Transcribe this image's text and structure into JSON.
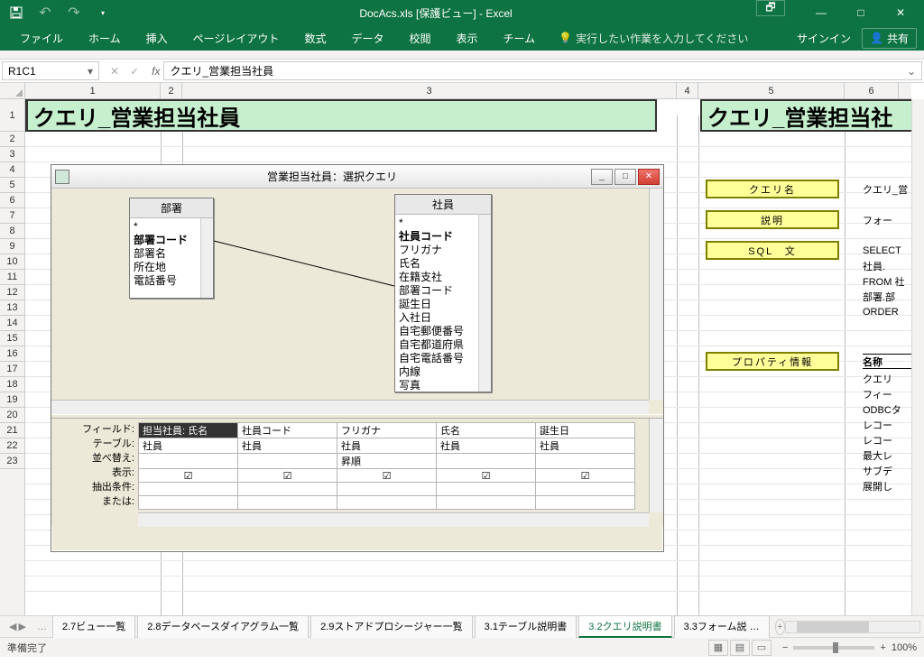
{
  "titlebar": {
    "title": "DocAcs.xls [保護ビュー] - Excel"
  },
  "win": {
    "restore": "🗗",
    "min": "—",
    "max": "□",
    "close": "✕"
  },
  "ribbon": {
    "tabs": [
      "ファイル",
      "ホーム",
      "挿入",
      "ページレイアウト",
      "数式",
      "データ",
      "校閲",
      "表示",
      "チーム"
    ],
    "tell_me": "実行したい作業を入力してください",
    "signin": "サインイン",
    "share": "共有"
  },
  "fbar": {
    "name": "R1C1",
    "value": "クエリ_営業担当社員",
    "fx": "fx"
  },
  "colhead": {
    "c1": "1",
    "c2": "2",
    "c3": "3",
    "c4": "4",
    "c5": "5",
    "c6": "6"
  },
  "rowhead": [
    "1",
    "2",
    "3",
    "4",
    "5",
    "6",
    "7",
    "8",
    "9",
    "10",
    "11",
    "12",
    "13",
    "14",
    "15",
    "16",
    "17",
    "18",
    "19",
    "20",
    "21",
    "22",
    "23"
  ],
  "banner": {
    "text": "クエリ_営業担当社員",
    "text2": "クエリ_営業担当社"
  },
  "right_labels": {
    "query_name": "クエリ名",
    "description": "説明",
    "sql": "SQL　文",
    "props": "プロパティ情報"
  },
  "right_cells": {
    "r3": "クエリ_営",
    "r5": "フォー",
    "r7": "SELECT",
    "r8": "社員.",
    "r9": "FROM 社",
    "r10": "部署.部",
    "r11": "ORDER",
    "r13": "名称",
    "r14": "クエリ",
    "r15": "フィー",
    "r16": "ODBCタ",
    "r17": "レコー",
    "r18": "レコー",
    "r19": "最大レ",
    "r20": "サブデ",
    "r21": "展開し"
  },
  "qwin": {
    "title": "営業担当社員：選択クエリ",
    "tbl1": {
      "name": "部署",
      "fields": [
        "*",
        "部署コード",
        "部署名",
        "所在地",
        "電話番号"
      ],
      "bold_idx": 1
    },
    "tbl2": {
      "name": "社員",
      "fields": [
        "*",
        "社員コード",
        "フリガナ",
        "氏名",
        "在籍支社",
        "部署コード",
        "誕生日",
        "入社日",
        "自宅郵便番号",
        "自宅都道府県",
        "自宅電話番号",
        "内線",
        "写真"
      ],
      "bold_idx": 1
    },
    "grid_rows": [
      "フィールド:",
      "テーブル:",
      "並べ替え:",
      "表示:",
      "抽出条件:",
      "または:"
    ],
    "cols": [
      {
        "field": "担当社員: 氏名",
        "table": "社員",
        "sort": "",
        "show": true
      },
      {
        "field": "社員コード",
        "table": "社員",
        "sort": "",
        "show": true
      },
      {
        "field": "フリガナ",
        "table": "社員",
        "sort": "昇順",
        "show": true
      },
      {
        "field": "氏名",
        "table": "社員",
        "sort": "",
        "show": true
      },
      {
        "field": "誕生日",
        "table": "社員",
        "sort": "",
        "show": true
      }
    ]
  },
  "sheet_tabs": {
    "ellipsis": "…",
    "tabs": [
      "2.7ビュー一覧",
      "2.8データベースダイアグラム一覧",
      "2.9ストアドプロシージャー一覧",
      "3.1テーブル説明書",
      "3.2クエリ説明書",
      "3.3フォーム説 …"
    ],
    "active_idx": 4
  },
  "status": {
    "ready": "準備完了",
    "zoom": "100%"
  }
}
